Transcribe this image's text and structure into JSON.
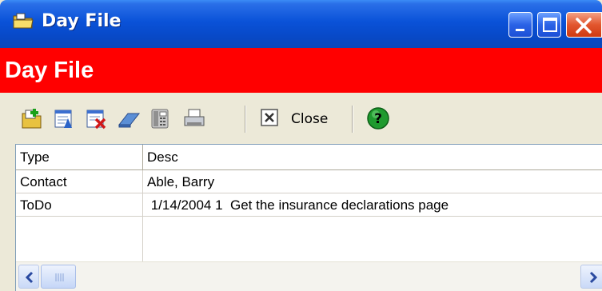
{
  "window": {
    "title": "Day File"
  },
  "banner": {
    "heading": "Day File",
    "background": "#ff0000"
  },
  "toolbar": {
    "icons": [
      "add-record-icon",
      "edit-record-icon",
      "delete-record-icon",
      "eraser-icon",
      "phone-icon",
      "print-icon"
    ],
    "close_label": "Close",
    "help_icon": "help-icon"
  },
  "grid": {
    "columns": [
      "Type",
      "Desc"
    ],
    "rows": [
      {
        "type": "Contact",
        "desc": "Able, Barry"
      },
      {
        "type": "ToDo",
        "desc": " 1/14/2004 1  Get the insurance declarations page"
      }
    ]
  },
  "colors": {
    "titlebar": "#0a52d8",
    "toolbar_bg": "#ece9d8",
    "close_button": "#e2562e"
  }
}
